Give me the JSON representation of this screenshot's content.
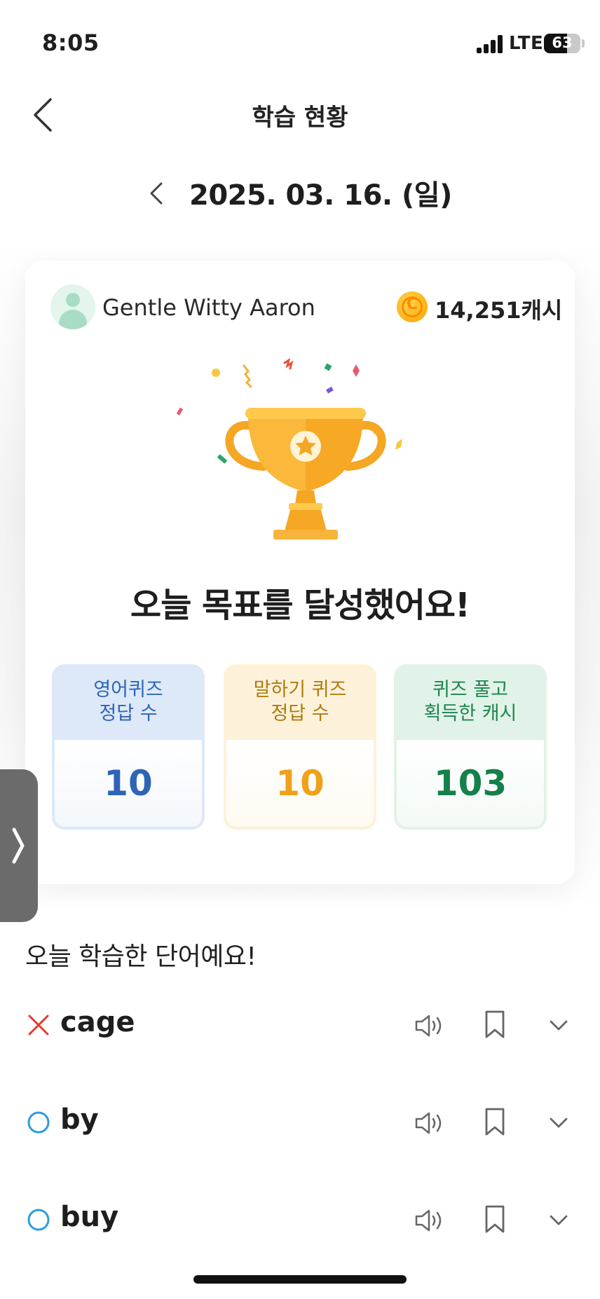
{
  "status_bar": {
    "time": "8:05",
    "network": "LTE",
    "battery": "63"
  },
  "header": {
    "title": "학습 현황"
  },
  "date_nav": {
    "date": "2025. 03. 16. (일)"
  },
  "profile": {
    "name": "Gentle Witty Aaron",
    "coin_letter": "C",
    "cash": "14,251캐시"
  },
  "achievement": {
    "title": "오늘 목표를 달성했어요!"
  },
  "stats": [
    {
      "label_line1": "영어퀴즈",
      "label_line2": "정답 수",
      "value": "10"
    },
    {
      "label_line1": "말하기 퀴즈",
      "label_line2": "정답 수",
      "value": "10"
    },
    {
      "label_line1": "퀴즈 풀고",
      "label_line2": "획득한 캐시",
      "value": "103"
    }
  ],
  "words_section": {
    "title": "오늘 학습한 단어예요!",
    "words": [
      {
        "word": "cage",
        "result": "wrong"
      },
      {
        "word": "by",
        "result": "correct"
      },
      {
        "word": "buy",
        "result": "correct"
      }
    ]
  },
  "colors": {
    "wrong": "#e5392b",
    "correct": "#2e9be0",
    "blue_value": "#2e64b8",
    "yellow_value": "#f0a11a",
    "green_value": "#14804a"
  }
}
